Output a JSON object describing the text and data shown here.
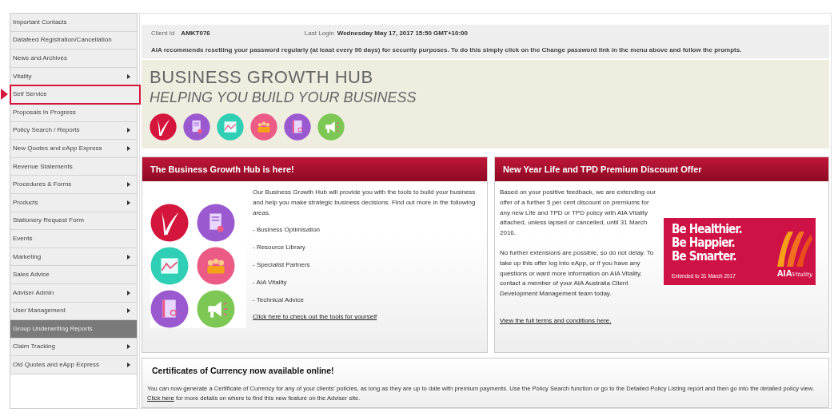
{
  "sidebar": {
    "items": [
      {
        "label": "Important Contacts",
        "submenu": false,
        "selected": false,
        "highlighted": false
      },
      {
        "label": "Datafeed Registration/Cancellation",
        "submenu": false,
        "selected": false,
        "highlighted": false
      },
      {
        "label": "News and Archives",
        "submenu": false,
        "selected": false,
        "highlighted": false
      },
      {
        "label": "Vitality",
        "submenu": true,
        "selected": false,
        "highlighted": false
      },
      {
        "label": "Self Service",
        "submenu": false,
        "selected": false,
        "highlighted": true
      },
      {
        "label": "Proposals In Progress",
        "submenu": false,
        "selected": false,
        "highlighted": false
      },
      {
        "label": "Policy Search / Reports",
        "submenu": true,
        "selected": false,
        "highlighted": false
      },
      {
        "label": "New Quotes and eApp Express",
        "submenu": true,
        "selected": false,
        "highlighted": false
      },
      {
        "label": "Revenue Statements",
        "submenu": false,
        "selected": false,
        "highlighted": false
      },
      {
        "label": "Procedures & Forms",
        "submenu": true,
        "selected": false,
        "highlighted": false
      },
      {
        "label": "Products",
        "submenu": true,
        "selected": false,
        "highlighted": false
      },
      {
        "label": "Stationery Request Form",
        "submenu": false,
        "selected": false,
        "highlighted": false
      },
      {
        "label": "Events",
        "submenu": false,
        "selected": false,
        "highlighted": false
      },
      {
        "label": "Marketing",
        "submenu": true,
        "selected": false,
        "highlighted": false
      },
      {
        "label": "Sales Advice",
        "submenu": false,
        "selected": false,
        "highlighted": false
      },
      {
        "label": "Adviser Admin",
        "submenu": true,
        "selected": false,
        "highlighted": false
      },
      {
        "label": "User Management",
        "submenu": true,
        "selected": false,
        "highlighted": false
      },
      {
        "label": "Group Underwriting Reports",
        "submenu": false,
        "selected": true,
        "highlighted": false
      },
      {
        "label": "Claim Tracking",
        "submenu": true,
        "selected": false,
        "highlighted": false
      },
      {
        "label": "Old Quotes and eApp Express",
        "submenu": true,
        "selected": false,
        "highlighted": false
      }
    ]
  },
  "info": {
    "client_id_label": "Client Id",
    "client_id": "AMKT076",
    "last_login_label": "Last Login",
    "last_login": "Wednesday May 17, 2017 15:50 GMT+10:00",
    "notice": "AIA recommends resetting your password regularly (at least every 90 days) for security purposes. To do this simply click on the Change password link in the menu above and follow the prompts."
  },
  "hero": {
    "title": "BUSINESS GROWTH HUB",
    "subtitle": "HELPING YOU BUILD YOUR BUSINESS",
    "icons": [
      {
        "kind": "check",
        "color": "#d4163c"
      },
      {
        "kind": "document",
        "color": "#9b59d0"
      },
      {
        "kind": "chart",
        "color": "#2ecfb4"
      },
      {
        "kind": "people",
        "color": "#ec5a86"
      },
      {
        "kind": "book",
        "color": "#9b59d0"
      },
      {
        "kind": "megaphone",
        "color": "#7dc855"
      }
    ]
  },
  "cards": [
    {
      "title": "The Business Growth Hub is here!",
      "intro": "Our Business Growth Hub will provide you with the tools to build your business and help you make strategic business decisions. Find out more in the following areas.",
      "items": [
        "- Business Optimisation",
        "- Resource Library",
        "- Specialist Partners",
        "- AIA Vitality",
        "- Technical Advice"
      ],
      "link": "Click here to check out the tools for yourself",
      "icons": [
        {
          "kind": "check",
          "color": "#d4163c"
        },
        {
          "kind": "document",
          "color": "#9b59d0"
        },
        {
          "kind": "chart",
          "color": "#2ecfb4"
        },
        {
          "kind": "people",
          "color": "#ec5a86"
        },
        {
          "kind": "book",
          "color": "#9b59d0"
        },
        {
          "kind": "megaphone",
          "color": "#7dc855"
        }
      ]
    },
    {
      "title": "New Year Life and TPD Premium Discount Offer",
      "paragraphs": [
        "Based on your positive feedback, we are extending our offer of a further 5 per cent discount on premiums for any new Life and TPD or TPD policy with AIA Vitality attached, unless lapsed or cancelled, until 31 March 2016.",
        "No further extensions are possible, so do not delay. To take up this offer log into eApp, or if you have any questions or want more information on AIA Vitality, contact a member of your AIA Australia Client Development Management team today."
      ],
      "link": "View the full terms and conditions here.",
      "promo": {
        "lines": [
          "Be Healthier.",
          "Be Happier.",
          "Be Smarter."
        ],
        "footnote": "Extended to 31 March 2017",
        "brand": "AIA",
        "brand_script": "Vitality"
      }
    }
  ],
  "certificates": {
    "title": "Certificates of Currency now available online!",
    "text_before": "You can now generate a Certificate of Currency for any of your clients' policies, as long as they are up to date with premium payments. Use the Policy Search function or go to the Detailed Policy Listing report and then go into the detailed policy view. ",
    "link": "Click here",
    "text_after": " for more details on where to find this new feature on the Adviser site."
  }
}
